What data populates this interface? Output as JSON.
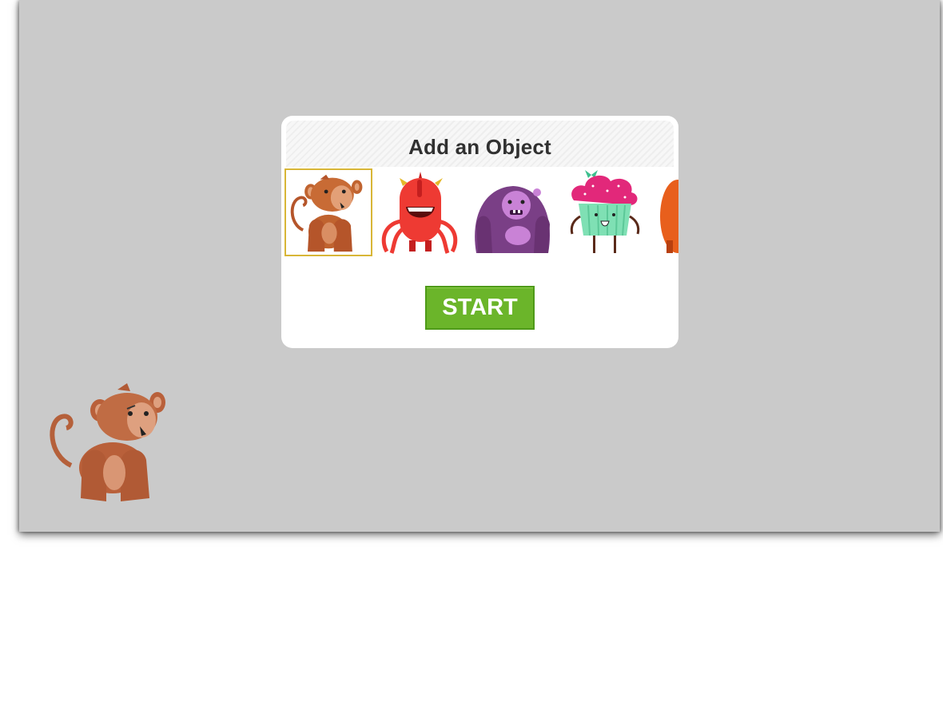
{
  "dialog": {
    "title": "Add an Object",
    "objects": [
      {
        "icon": "monkey-icon",
        "selected": true
      },
      {
        "icon": "red-octopus-monster-icon",
        "selected": false
      },
      {
        "icon": "purple-gorilla-monster-icon",
        "selected": false
      },
      {
        "icon": "cupcake-character-icon",
        "selected": false
      },
      {
        "icon": "orange-character-icon",
        "selected": false
      }
    ],
    "start_label": "START"
  },
  "stage": {
    "character": "monkey-icon"
  },
  "colors": {
    "stage_background": "#cacaca",
    "selection_border": "#d8b637",
    "start_button": "#6bb52a"
  }
}
